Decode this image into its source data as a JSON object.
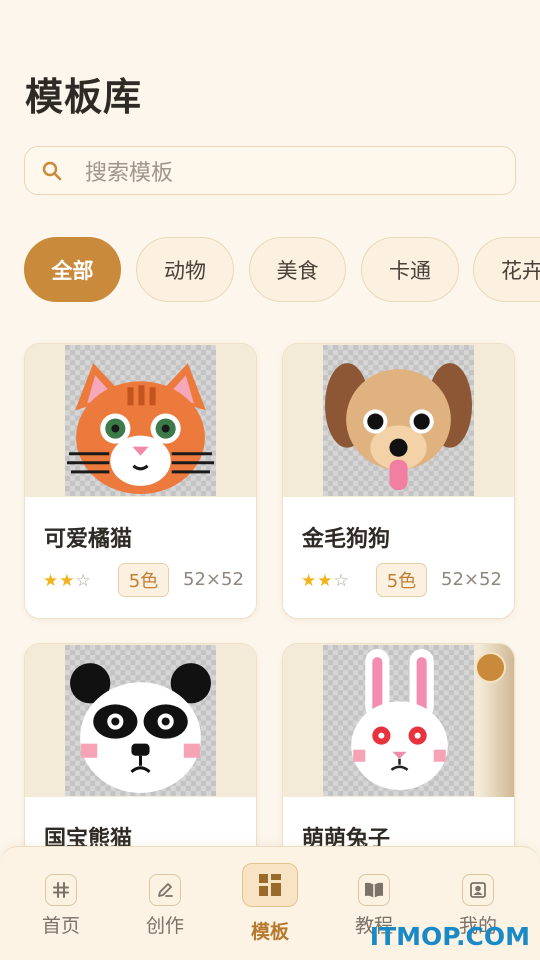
{
  "page_title": "模板库",
  "search": {
    "placeholder": "搜索模板",
    "icon": "search-icon"
  },
  "categories": [
    {
      "label": "全部",
      "active": true
    },
    {
      "label": "动物",
      "active": false
    },
    {
      "label": "美食",
      "active": false
    },
    {
      "label": "卡通",
      "active": false
    },
    {
      "label": "花卉",
      "active": false
    }
  ],
  "templates": [
    {
      "name": "可爱橘猫",
      "rating": 2,
      "rating_max": 3,
      "stars": "★★☆",
      "colors": "5色",
      "size": "52×52",
      "locked": false,
      "image": "orange-cat"
    },
    {
      "name": "金毛狗狗",
      "rating": 2,
      "rating_max": 3,
      "stars": "★★☆",
      "colors": "5色",
      "size": "52×52",
      "locked": false,
      "image": "golden-dog"
    },
    {
      "name": "国宝熊猫",
      "locked": false,
      "image": "panda"
    },
    {
      "name": "萌萌兔子",
      "locked": true,
      "image": "white-rabbit"
    }
  ],
  "tabbar": [
    {
      "label": "首页",
      "icon": "hash-icon",
      "active": false
    },
    {
      "label": "创作",
      "icon": "pencil-icon",
      "active": false
    },
    {
      "label": "模板",
      "icon": "template-grid-icon",
      "active": true
    },
    {
      "label": "教程",
      "icon": "book-icon",
      "active": false
    },
    {
      "label": "我的",
      "icon": "profile-icon",
      "active": false
    }
  ],
  "watermark": "ITMOP.COM",
  "colors": {
    "accent": "#c98a3c",
    "background": "#fcf6ec",
    "star": "#f2b21d"
  }
}
